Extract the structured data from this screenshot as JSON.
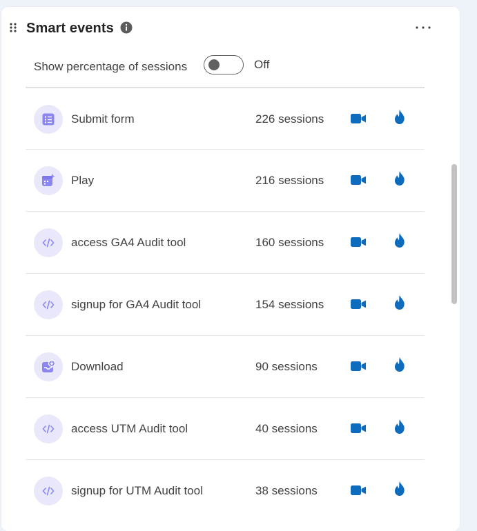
{
  "widget": {
    "title": "Smart events",
    "info_icon": "info-icon",
    "more_icon": "more-horizontal-icon",
    "drag_icon": "drag-handle-icon"
  },
  "toggle": {
    "label": "Show percentage of sessions",
    "state": "Off",
    "checked": false
  },
  "events": [
    {
      "name": "Submit form",
      "count": "226 sessions",
      "icon": "form-icon"
    },
    {
      "name": "Play",
      "count": "216 sessions",
      "icon": "play-calendar-icon"
    },
    {
      "name": "access GA4 Audit tool",
      "count": "160 sessions",
      "icon": "code-icon"
    },
    {
      "name": "signup for GA4 Audit tool",
      "count": "154 sessions",
      "icon": "code-icon"
    },
    {
      "name": "Download",
      "count": "90 sessions",
      "icon": "download-icon"
    },
    {
      "name": "access UTM Audit tool",
      "count": "40 sessions",
      "icon": "code-icon"
    },
    {
      "name": "signup for UTM Audit tool",
      "count": "38 sessions",
      "icon": "code-icon"
    }
  ],
  "row_actions": {
    "recordings_icon": "video-camera-icon",
    "heatmap_icon": "flame-icon"
  },
  "colors": {
    "accent": "#0f6cbd",
    "icon_purple": "#8b86f0",
    "icon_bg": "#e9e8fb"
  }
}
